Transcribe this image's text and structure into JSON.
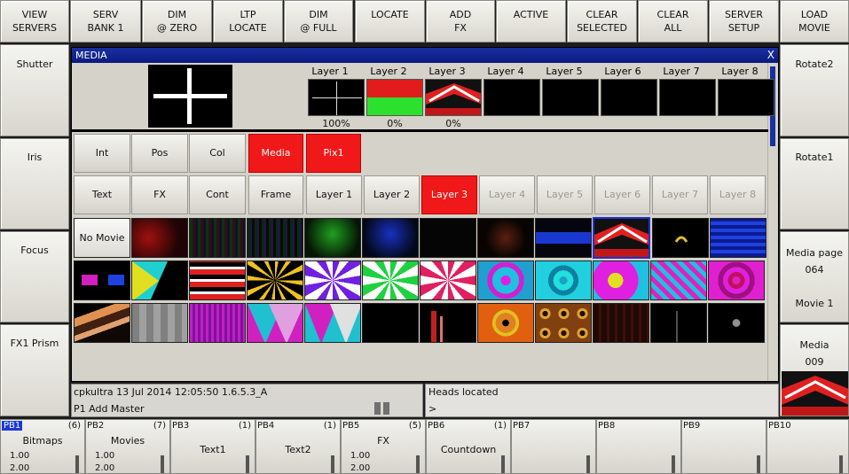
{
  "top_buttons": [
    {
      "l1": "VIEW",
      "l2": "SERVERS"
    },
    {
      "l1": "SERV",
      "l2": "BANK 1"
    },
    {
      "l1": "DIM",
      "l2": "@ ZERO"
    },
    {
      "l1": "LTP",
      "l2": "LOCATE"
    },
    {
      "l1": "DIM",
      "l2": "@ FULL"
    },
    {
      "l1": "LOCATE",
      "l2": ""
    },
    {
      "l1": "ADD",
      "l2": "FX"
    },
    {
      "l1": "ACTIVE",
      "l2": ""
    },
    {
      "l1": "CLEAR",
      "l2": "SELECTED"
    },
    {
      "l1": "CLEAR",
      "l2": "ALL"
    },
    {
      "l1": "SERVER",
      "l2": "SETUP"
    },
    {
      "l1": "LOAD",
      "l2": "MOVIE"
    }
  ],
  "left_buttons": [
    "Shutter",
    "Iris",
    "Focus",
    "FX1 Prism"
  ],
  "right_buttons": {
    "rotate2": "Rotate2",
    "rotate1": "Rotate1",
    "media_page_label": "Media page",
    "media_page_value": "064",
    "movie_label": "Movie 1",
    "media_label": "Media",
    "media_value": "009"
  },
  "window": {
    "title": "MEDIA",
    "close": "X"
  },
  "layers": [
    {
      "label": "Layer 1",
      "pct": "100%"
    },
    {
      "label": "Layer 2",
      "pct": "0%"
    },
    {
      "label": "Layer 3",
      "pct": "0%"
    },
    {
      "label": "Layer 4",
      "pct": ""
    },
    {
      "label": "Layer 5",
      "pct": ""
    },
    {
      "label": "Layer 6",
      "pct": ""
    },
    {
      "label": "Layer 7",
      "pct": ""
    },
    {
      "label": "Layer 8",
      "pct": ""
    }
  ],
  "attr_tabs": [
    "Int",
    "Pos",
    "Col",
    "Media"
  ],
  "pix_tab": "Pix1",
  "mode_tabs": [
    "Text",
    "FX",
    "Cont",
    "Frame"
  ],
  "layer_tabs": [
    "Layer 1",
    "Layer 2",
    "Layer 3",
    "Layer 4",
    "Layer 5",
    "Layer 6",
    "Layer 7",
    "Layer 8"
  ],
  "no_movie": "No Movie",
  "status": {
    "version": "cpkultra 13 Jul 2014 12:05:50 1.6.5.3_A",
    "command": "P1  Add Master",
    "message": "Heads located",
    "prompt": ">"
  },
  "playbacks": [
    {
      "name": "PB1",
      "count": "(6)",
      "title": "Bitmaps",
      "v1": "1.00",
      "v2": "2.00"
    },
    {
      "name": "PB2",
      "count": "(7)",
      "title": "Movies",
      "v1": "1.00",
      "v2": "2.00"
    },
    {
      "name": "PB3",
      "count": "(1)",
      "title": "Text1",
      "v1": "",
      "v2": ""
    },
    {
      "name": "PB4",
      "count": "(1)",
      "title": "Text2",
      "v1": "",
      "v2": ""
    },
    {
      "name": "PB5",
      "count": "(5)",
      "title": "FX",
      "v1": "1.00",
      "v2": "2.00"
    },
    {
      "name": "PB6",
      "count": "(1)",
      "title": "Countdown",
      "v1": "",
      "v2": ""
    },
    {
      "name": "PB7",
      "count": "",
      "title": "",
      "v1": "",
      "v2": ""
    },
    {
      "name": "PB8",
      "count": "",
      "title": "",
      "v1": "",
      "v2": ""
    },
    {
      "name": "PB9",
      "count": "",
      "title": "",
      "v1": "",
      "v2": ""
    },
    {
      "name": "PB10",
      "count": "",
      "title": "",
      "v1": "",
      "v2": ""
    }
  ],
  "colors": {
    "active_tab": "#f01818",
    "titlebar": "#1a2fa0",
    "selected_pb": "#1a3ad8"
  }
}
